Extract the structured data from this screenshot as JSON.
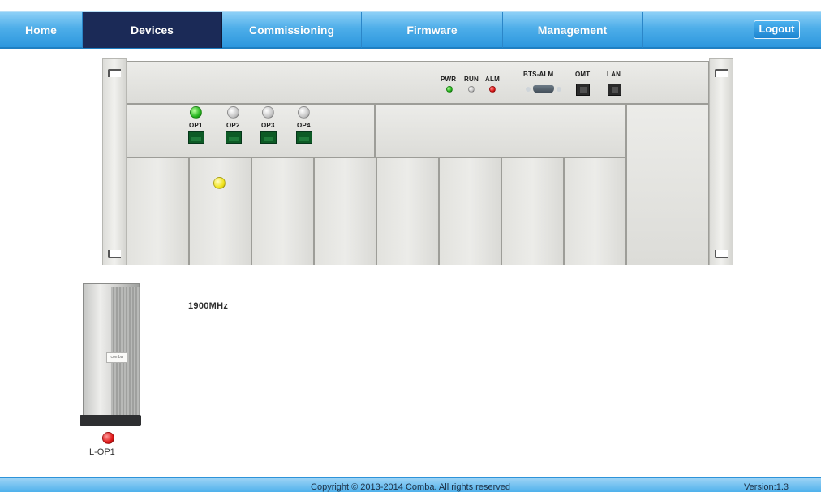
{
  "nav": {
    "tabs": [
      {
        "label": "Home",
        "active": false
      },
      {
        "label": "Devices",
        "active": true
      },
      {
        "label": "Commissioning",
        "active": false
      },
      {
        "label": "Firmware",
        "active": false
      },
      {
        "label": "Management",
        "active": false
      }
    ],
    "logout_label": "Logout"
  },
  "chassis": {
    "status_labels": {
      "pwr": "PWR",
      "run": "RUN",
      "alm": "ALM"
    },
    "status_leds": {
      "pwr": "green",
      "run": "grey",
      "alm": "red"
    },
    "ports": {
      "bts_alm": "BTS-ALM",
      "omt": "OMT",
      "lan": "LAN"
    },
    "optical_ports": [
      {
        "label": "OP1",
        "led": "green"
      },
      {
        "label": "OP2",
        "led": "grey"
      },
      {
        "label": "OP3",
        "led": "grey"
      },
      {
        "label": "OP4",
        "led": "grey"
      }
    ],
    "slot_module": {
      "label": "1900MHz",
      "led": "yellow"
    }
  },
  "remote_unit": {
    "label": "L-OP1",
    "badge": "comba",
    "led": "red"
  },
  "footer": {
    "copyright": "Copyright © 2013-2014 Comba. All rights reserved",
    "version": "Version:1.3"
  },
  "colors": {
    "nav_blue": "#2c97de",
    "active_tab": "#1b2a57",
    "led_green": "#26b51e",
    "led_red": "#e01818",
    "led_yellow": "#f2e51f"
  }
}
